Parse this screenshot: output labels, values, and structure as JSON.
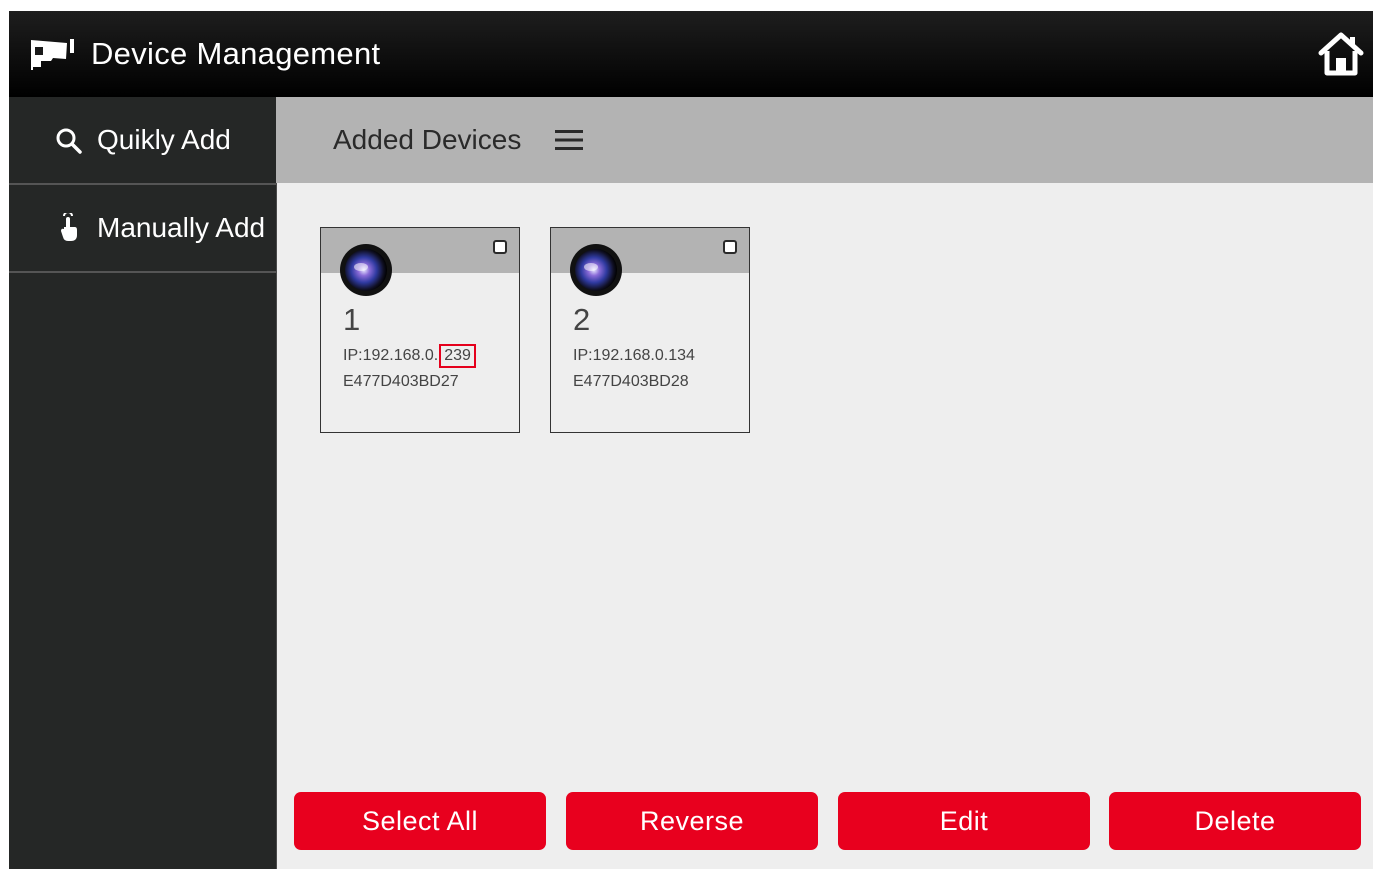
{
  "header": {
    "title": "Device Management",
    "app_icon": "camera-icon",
    "home_icon": "home-icon"
  },
  "sidebar": {
    "items": [
      {
        "label": "Quikly Add",
        "icon": "search-icon"
      },
      {
        "label": "Manually Add",
        "icon": "hand-pointer-icon"
      }
    ]
  },
  "content": {
    "title": "Added Devices",
    "menu_icon": "hamburger-menu-icon",
    "devices": [
      {
        "number": "1",
        "ip_prefix": "IP:192.168.0.",
        "ip_highlight": "239",
        "mac": "E477D403BD27",
        "checked": false
      },
      {
        "number": "2",
        "ip": "IP:192.168.0.134",
        "mac": "E477D403BD28",
        "checked": false
      }
    ]
  },
  "actions": {
    "select_all": "Select All",
    "reverse": "Reverse",
    "edit": "Edit",
    "delete": "Delete"
  },
  "colors": {
    "header_bg": "#000000",
    "sidebar_bg": "#252726",
    "subheader_bg": "#b3b3b3",
    "content_bg": "#eeeeee",
    "accent": "#e8001e",
    "highlight_border": "#e5001c"
  }
}
